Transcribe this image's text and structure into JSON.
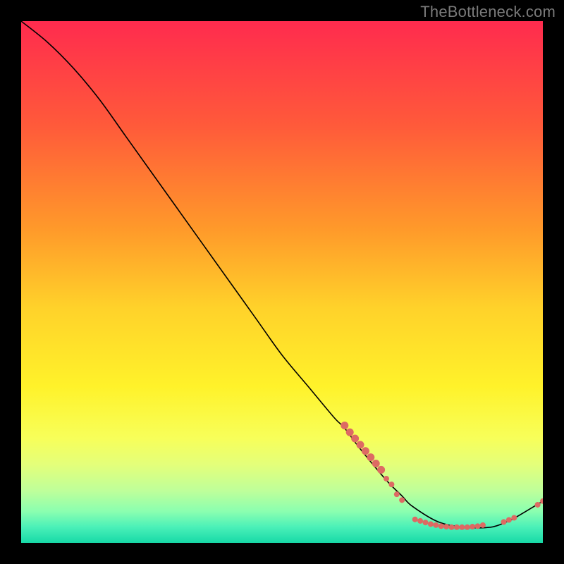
{
  "watermark": "TheBottleneck.com",
  "chart_data": {
    "type": "line",
    "title": "",
    "xlabel": "",
    "ylabel": "",
    "xlim": [
      0,
      100
    ],
    "ylim": [
      0,
      100
    ],
    "curve": {
      "name": "bottleneck-curve",
      "x": [
        0,
        5,
        10,
        15,
        20,
        25,
        30,
        35,
        40,
        45,
        50,
        55,
        60,
        62,
        65,
        70,
        73,
        75,
        80,
        85,
        90,
        93,
        95,
        100
      ],
      "y": [
        100,
        96,
        91,
        85,
        78,
        71,
        64,
        57,
        50,
        43,
        36,
        30,
        24,
        22,
        18,
        12,
        9,
        7,
        4,
        3,
        3,
        4,
        5,
        8
      ],
      "color": "#000000"
    },
    "points_cluster": {
      "name": "highlight-points",
      "color": "#dd6a63",
      "radius_small": 4,
      "radius_large": 5.5,
      "points": [
        {
          "x": 62.0,
          "y": 22.5,
          "r": 5.5
        },
        {
          "x": 63.0,
          "y": 21.2,
          "r": 5.5
        },
        {
          "x": 64.0,
          "y": 20.0,
          "r": 5.5
        },
        {
          "x": 65.0,
          "y": 18.8,
          "r": 5.5
        },
        {
          "x": 66.0,
          "y": 17.6,
          "r": 5.5
        },
        {
          "x": 67.0,
          "y": 16.4,
          "r": 5.5
        },
        {
          "x": 68.0,
          "y": 15.2,
          "r": 5.5
        },
        {
          "x": 69.0,
          "y": 14.0,
          "r": 5.5
        },
        {
          "x": 70.0,
          "y": 12.3,
          "r": 4.0
        },
        {
          "x": 71.0,
          "y": 11.2,
          "r": 4.0
        },
        {
          "x": 72.0,
          "y": 9.3,
          "r": 4.0
        },
        {
          "x": 73.0,
          "y": 8.2,
          "r": 4.0
        },
        {
          "x": 75.5,
          "y": 4.5,
          "r": 4.0
        },
        {
          "x": 76.5,
          "y": 4.2,
          "r": 4.0
        },
        {
          "x": 77.5,
          "y": 3.9,
          "r": 4.0
        },
        {
          "x": 78.5,
          "y": 3.6,
          "r": 4.0
        },
        {
          "x": 79.5,
          "y": 3.4,
          "r": 4.0
        },
        {
          "x": 80.5,
          "y": 3.2,
          "r": 4.0
        },
        {
          "x": 81.5,
          "y": 3.1,
          "r": 4.0
        },
        {
          "x": 82.5,
          "y": 3.0,
          "r": 4.0
        },
        {
          "x": 83.5,
          "y": 3.0,
          "r": 4.0
        },
        {
          "x": 84.5,
          "y": 3.0,
          "r": 4.0
        },
        {
          "x": 85.5,
          "y": 3.0,
          "r": 4.0
        },
        {
          "x": 86.5,
          "y": 3.1,
          "r": 4.0
        },
        {
          "x": 87.5,
          "y": 3.2,
          "r": 4.0
        },
        {
          "x": 88.5,
          "y": 3.4,
          "r": 4.0
        },
        {
          "x": 92.5,
          "y": 4.0,
          "r": 4.0
        },
        {
          "x": 93.5,
          "y": 4.4,
          "r": 4.0
        },
        {
          "x": 94.5,
          "y": 4.8,
          "r": 4.0
        },
        {
          "x": 99.0,
          "y": 7.3,
          "r": 4.0
        },
        {
          "x": 100.0,
          "y": 8.0,
          "r": 4.0
        }
      ]
    },
    "gradient": {
      "type": "vertical",
      "stops": [
        {
          "offset": 0.0,
          "color": "#ff2b4e"
        },
        {
          "offset": 0.2,
          "color": "#ff5a3a"
        },
        {
          "offset": 0.4,
          "color": "#ff9a2a"
        },
        {
          "offset": 0.55,
          "color": "#ffd22a"
        },
        {
          "offset": 0.7,
          "color": "#fff22a"
        },
        {
          "offset": 0.8,
          "color": "#f7ff5a"
        },
        {
          "offset": 0.85,
          "color": "#e4ff7a"
        },
        {
          "offset": 0.9,
          "color": "#bfff9a"
        },
        {
          "offset": 0.94,
          "color": "#8affb0"
        },
        {
          "offset": 0.97,
          "color": "#4af0b8"
        },
        {
          "offset": 1.0,
          "color": "#17d9a7"
        }
      ]
    }
  }
}
